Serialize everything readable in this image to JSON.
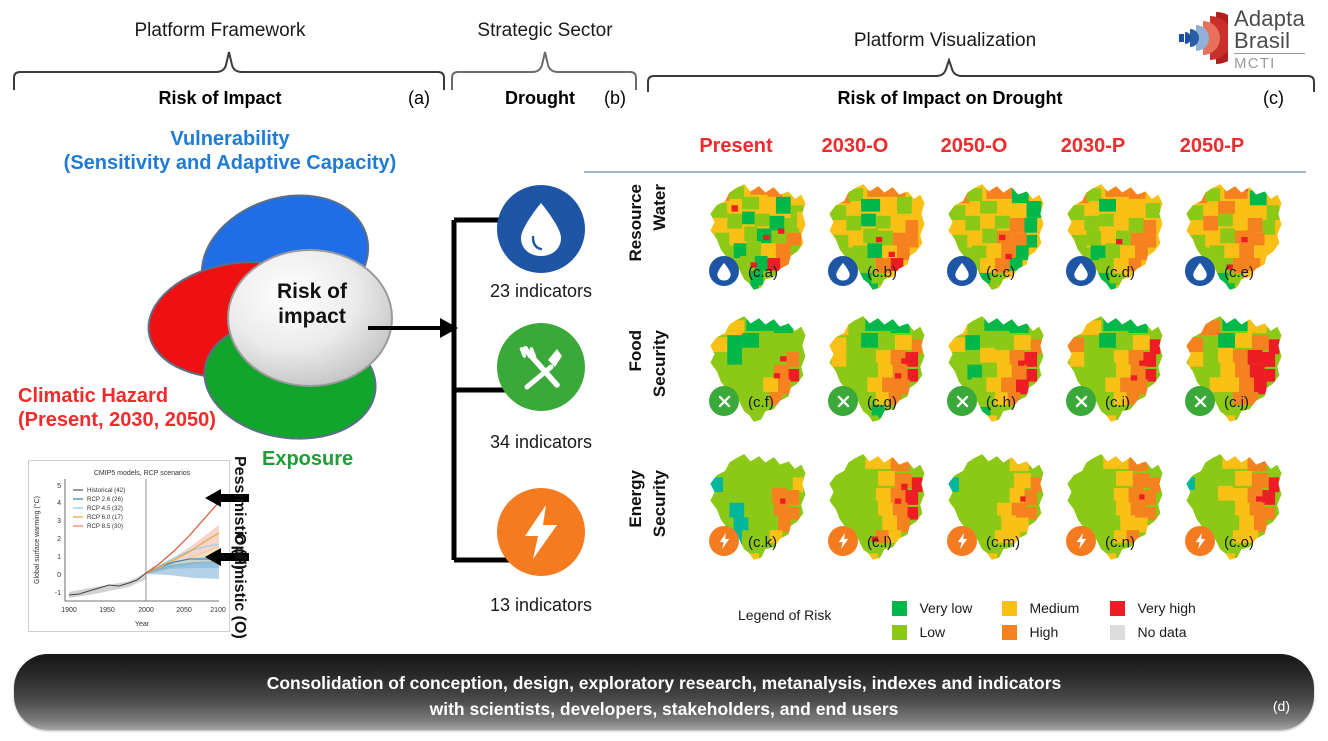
{
  "figure": {
    "title": "AdaptaBrasil Platform Framework — Risk of Impact on Drought"
  },
  "logo": {
    "line1": "Adapta",
    "line2": "Brasil",
    "line3": "MCTI",
    "colors": [
      "#1f4fa3",
      "#e8705a",
      "#c9302c",
      "#b01f1f"
    ]
  },
  "braces": [
    {
      "caption": "Platform  Framework",
      "title": "Risk of Impact",
      "letter": "(a)"
    },
    {
      "caption": "Strategic Sector",
      "title": "Drought",
      "letter": "(b)"
    },
    {
      "caption": "Platform Visualization",
      "title": "Risk of Impact on Drought",
      "letter": "(c)"
    }
  ],
  "venn": {
    "vulnerability_line1": "Vulnerability",
    "vulnerability_line2": "(Sensitivity and Adaptive Capacity)",
    "hazard_line1": "Climatic Hazard",
    "hazard_line2": "(Present, 2030, 2050)",
    "exposure": "Exposure",
    "center_line1": "Risk of",
    "center_line2": "impact",
    "colors": {
      "vulnerability": "#1f7bd8",
      "hazard": "#ef2b2b",
      "exposure": "#1e9e34",
      "center": "#d9d9d9"
    }
  },
  "scenario_labels": {
    "pessimistic": "Pessimistic (P)",
    "optimistic": "Optimistic (O)"
  },
  "chart_data": {
    "type": "line",
    "title": "CMIP5 models, RCP scenarios",
    "xlabel": "Year",
    "ylabel": "Global surface warming (°C)",
    "xlim": [
      1900,
      2100
    ],
    "ylim": [
      -1.4,
      5.4
    ],
    "xticks": [
      "1900",
      "1950",
      "2000",
      "2050",
      "2100"
    ],
    "yticks": [
      "-1",
      "0",
      "1",
      "2",
      "3",
      "4",
      "5"
    ],
    "grid": false,
    "legend_position": "top-left",
    "series": [
      {
        "name": "Historical (42)",
        "color": "#555555",
        "x": [
          1900,
          1910,
          1920,
          1930,
          1940,
          1950,
          1960,
          1970,
          1980,
          1990,
          2000,
          2005
        ],
        "values": [
          -0.75,
          -0.72,
          -0.62,
          -0.5,
          -0.36,
          -0.4,
          -0.33,
          -0.3,
          -0.18,
          0.0,
          0.2,
          0.28
        ]
      },
      {
        "name": "RCP 2.6 (26)",
        "color": "#2b7bba",
        "x": [
          2005,
          2020,
          2040,
          2060,
          2080,
          2100
        ],
        "values": [
          0.28,
          0.62,
          0.9,
          1.0,
          1.0,
          1.0
        ]
      },
      {
        "name": "RCP 4.5 (32)",
        "color": "#8ecae6",
        "x": [
          2005,
          2020,
          2040,
          2060,
          2080,
          2100
        ],
        "values": [
          0.28,
          0.65,
          1.05,
          1.45,
          1.7,
          1.85
        ]
      },
      {
        "name": "RCP 6.0 (17)",
        "color": "#e0a83c",
        "x": [
          2005,
          2020,
          2040,
          2060,
          2080,
          2100
        ],
        "values": [
          0.28,
          0.6,
          0.95,
          1.4,
          1.95,
          2.45
        ]
      },
      {
        "name": "RCP 8.5 (30)",
        "color": "#e07a5f",
        "x": [
          2005,
          2020,
          2040,
          2060,
          2080,
          2100
        ],
        "values": [
          0.28,
          0.72,
          1.35,
          2.25,
          3.2,
          4.2
        ]
      }
    ],
    "annotations": [
      {
        "label": "Pessimistic (P)",
        "points_to_series": "RCP 8.5 (30)",
        "y": 4.2
      },
      {
        "label": "Optimistic (O)",
        "points_to_series": "RCP 4.5 (32)",
        "y": 1.6
      }
    ]
  },
  "sectors": [
    {
      "name": "Water Resource",
      "icon": "water-drop-icon",
      "color": "#1f55a5",
      "indicators": "23 indicators",
      "row_label_line1": "Resource",
      "row_label_line2": "Water"
    },
    {
      "name": "Food Security",
      "icon": "fork-knife-icon",
      "color": "#3aa93a",
      "indicators": "34 indicators",
      "row_label_line1": "Food",
      "row_label_line2": "Security"
    },
    {
      "name": "Energy Security",
      "icon": "lightning-bolt-icon",
      "color": "#f47b20",
      "indicators": "13 indicators",
      "row_label_line1": "Energy",
      "row_label_line2": "Security"
    }
  ],
  "map_grid": {
    "columns": [
      "Present",
      "2030-O",
      "2050-O",
      "2030-P",
      "2050-P"
    ],
    "rows": [
      {
        "sector": "Water Resource",
        "panels": [
          "(c.a)",
          "(c.b)",
          "(c.c)",
          "(c.d)",
          "(c.e)"
        ]
      },
      {
        "sector": "Food Security",
        "panels": [
          "(c.f)",
          "(c.g)",
          "(c.h)",
          "(c.i)",
          "(c.j)"
        ]
      },
      {
        "sector": "Energy Security",
        "panels": [
          "(c.k)",
          "(c.l)",
          "(c.m)",
          "(c.n)",
          "(c.o)"
        ]
      }
    ]
  },
  "legend": {
    "title": "Legend of Risk",
    "items": [
      {
        "label": "Very low",
        "color": "#00b84a"
      },
      {
        "label": "Low",
        "color": "#8bc916"
      },
      {
        "label": "Medium",
        "color": "#fbc016"
      },
      {
        "label": "High",
        "color": "#f5821f"
      },
      {
        "label": "Very high",
        "color": "#ee1c25"
      },
      {
        "label": "No data",
        "color": "#dcdcdc"
      }
    ]
  },
  "banner": {
    "line1": "Consolidation of conception, design, exploratory research, metanalysis, indexes and indicators",
    "line2": "with scientists, developers, stakeholders,  and end users",
    "letter": "(d)"
  }
}
